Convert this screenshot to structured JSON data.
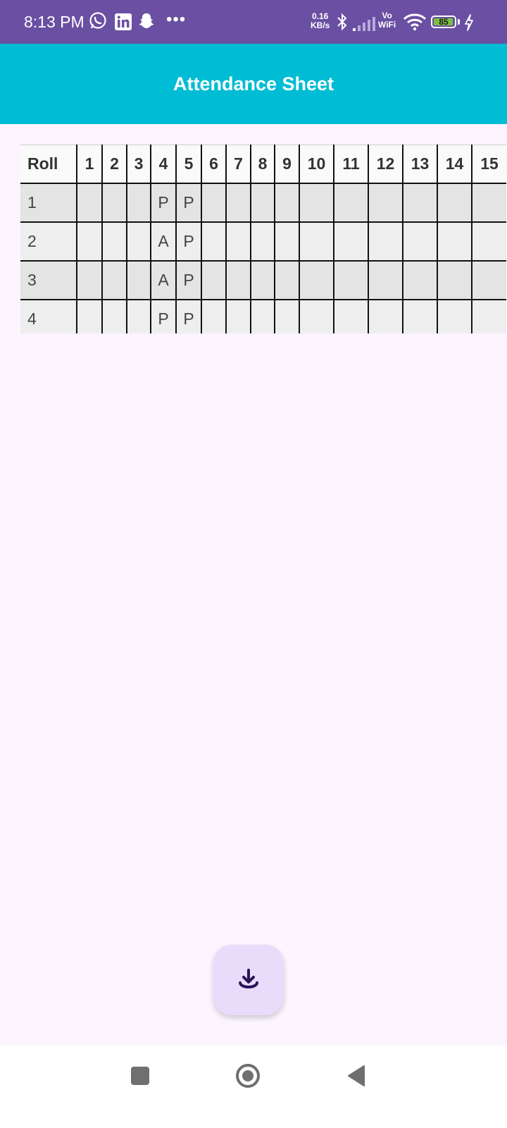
{
  "status_bar": {
    "time": "8:13 PM",
    "net_speed_value": "0.16",
    "net_speed_unit": "KB/s",
    "vo_label": "Vo",
    "wifi_label": "WiFi",
    "battery": "85",
    "bg_color": "#6a4fa3",
    "icons": [
      "whatsapp-icon",
      "linkedin-icon",
      "snapchat-icon",
      "more-dots",
      "bluetooth-icon",
      "signal-icon",
      "wifi-icon",
      "battery-icon",
      "charging-icon"
    ]
  },
  "app_bar": {
    "title": "Attendance Sheet",
    "bg_color": "#00bcd4"
  },
  "table": {
    "headers": [
      "Roll",
      "1",
      "2",
      "3",
      "4",
      "5",
      "6",
      "7",
      "8",
      "9",
      "10",
      "11",
      "12",
      "13",
      "14",
      "15"
    ],
    "rows": [
      [
        "1",
        "",
        "",
        "",
        "P",
        "P",
        "",
        "",
        "",
        "",
        "",
        "",
        "",
        "",
        "",
        ""
      ],
      [
        "2",
        "",
        "",
        "",
        "A",
        "P",
        "",
        "",
        "",
        "",
        "",
        "",
        "",
        "",
        "",
        ""
      ],
      [
        "3",
        "",
        "",
        "",
        "A",
        "P",
        "",
        "",
        "",
        "",
        "",
        "",
        "",
        "",
        "",
        ""
      ],
      [
        "4",
        "",
        "",
        "",
        "P",
        "P",
        "",
        "",
        "",
        "",
        "",
        "",
        "",
        "",
        "",
        ""
      ]
    ]
  },
  "fab": {
    "icon": "download-icon",
    "bg_color": "#e9dcfb"
  },
  "nav_bar": {
    "icons": [
      "recents-square-icon",
      "home-circle-icon",
      "back-triangle-icon"
    ]
  }
}
